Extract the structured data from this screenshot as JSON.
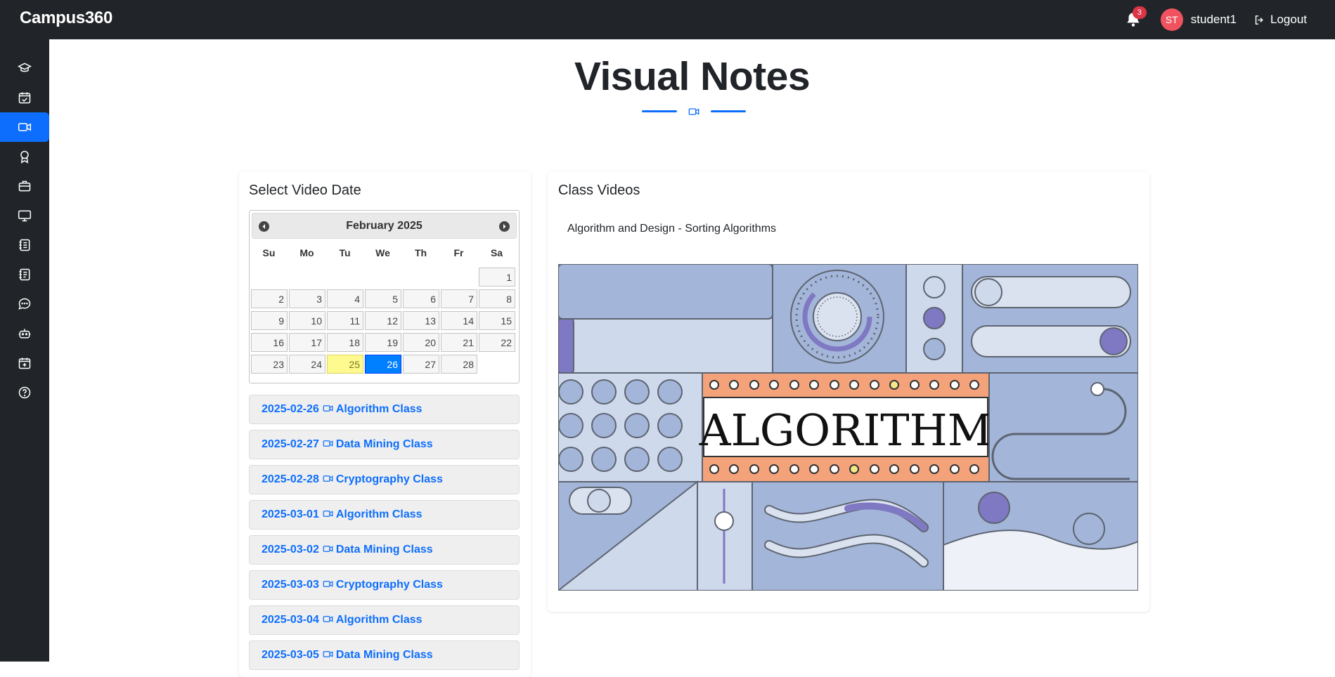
{
  "app": {
    "brand": "Campus360"
  },
  "header": {
    "notification_count": "3",
    "avatar_initials": "ST",
    "username": "student1",
    "logout_label": "Logout"
  },
  "sidebar": {
    "items": [
      {
        "icon": "graduation-cap-icon"
      },
      {
        "icon": "calendar-check-icon"
      },
      {
        "icon": "video-camera-icon",
        "active": true
      },
      {
        "icon": "award-icon"
      },
      {
        "icon": "briefcase-icon"
      },
      {
        "icon": "monitor-icon"
      },
      {
        "icon": "journal-icon"
      },
      {
        "icon": "notes-icon"
      },
      {
        "icon": "chat-icon"
      },
      {
        "icon": "robot-icon"
      },
      {
        "icon": "calendar-plus-icon"
      },
      {
        "icon": "help-icon"
      }
    ]
  },
  "page": {
    "title": "Visual Notes"
  },
  "left_panel": {
    "heading": "Select Video Date",
    "calendar": {
      "month_label": "February 2025",
      "weekdays": [
        "Su",
        "Mo",
        "Tu",
        "We",
        "Th",
        "Fr",
        "Sa"
      ],
      "days": [
        "1",
        "2",
        "3",
        "4",
        "5",
        "6",
        "7",
        "8",
        "9",
        "10",
        "11",
        "12",
        "13",
        "14",
        "15",
        "16",
        "17",
        "18",
        "19",
        "20",
        "21",
        "22",
        "23",
        "24",
        "25",
        "26",
        "27",
        "28"
      ],
      "first_weekday_index": 6,
      "today": "25",
      "selected": "26"
    },
    "videos": [
      {
        "date": "2025-02-26",
        "name": "Algorithm Class"
      },
      {
        "date": "2025-02-27",
        "name": "Data Mining Class"
      },
      {
        "date": "2025-02-28",
        "name": "Cryptography Class"
      },
      {
        "date": "2025-03-01",
        "name": "Algorithm Class"
      },
      {
        "date": "2025-03-02",
        "name": "Data Mining Class"
      },
      {
        "date": "2025-03-03",
        "name": "Cryptography Class"
      },
      {
        "date": "2025-03-04",
        "name": "Algorithm Class"
      },
      {
        "date": "2025-03-05",
        "name": "Data Mining Class"
      }
    ]
  },
  "right_panel": {
    "heading": "Class Videos",
    "video_title": "Algorithm and Design - Sorting Algorithms",
    "thumbnail_word": "ALGORITHM"
  },
  "colors": {
    "topbar": "#212529",
    "accent": "#0d6efd",
    "today_highlight": "#fffa90",
    "thumb_blue": "#a3b5d8",
    "thumb_orange": "#f4a27a",
    "thumb_purple": "#7f78c2"
  }
}
